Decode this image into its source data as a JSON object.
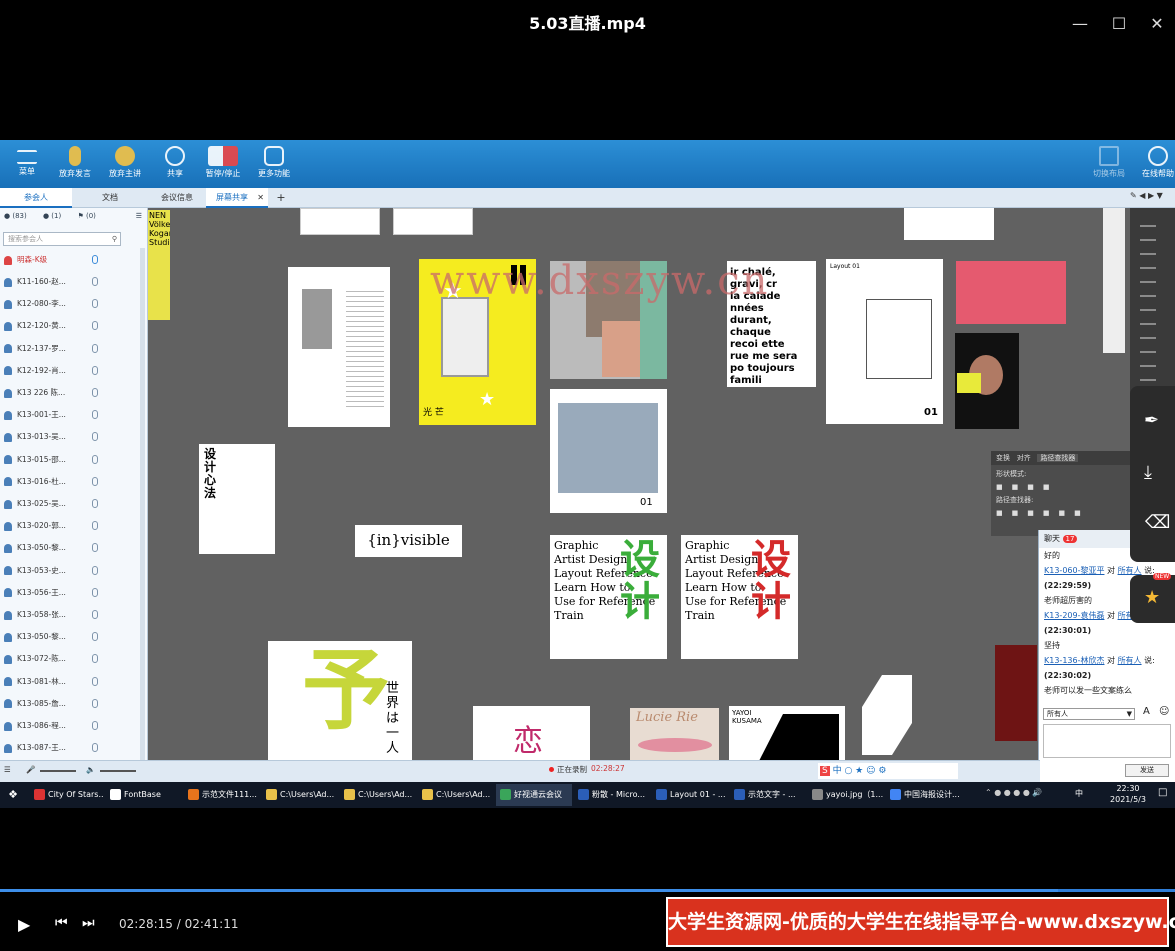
{
  "player": {
    "title": "5.03直播.mp4",
    "time_display": "02:28:15 / 02:41:11",
    "progress": 0.9,
    "banner": "大学生资源网-优质的大学生在线指导平台-www.dxszyw.cn"
  },
  "watermark": "www.dxszyw.cn",
  "toolbar": {
    "menu": "菜单",
    "give_speech": "放弃发言",
    "give_host": "放弃主讲",
    "share": "共享",
    "pause_stop": "暂停/停止",
    "more": "更多功能",
    "online_help": "在线帮助",
    "layout": "切换布局"
  },
  "tabs": {
    "participants": "参会人",
    "docs": "文档",
    "meeting_info": "会议信息",
    "screen_share": "屏幕共享",
    "add": "+"
  },
  "side": {
    "count_all": "(83)",
    "count_mic": "(1)",
    "count_flag": "(0)",
    "search_placeholder": "搜索参会人",
    "host": "明森-K级",
    "people": [
      "K11-160-赵...",
      "K12-080-李...",
      "K12-120-黄...",
      "K12-137-罗...",
      "K12-192-肖...",
      "K13 226 陈...",
      "K13-001-王...",
      "K13-013-吴...",
      "K13-015-邵...",
      "K13-016-杜...",
      "K13-025-吴...",
      "K13-020-郭...",
      "K13-050-黎...",
      "K13-053-史...",
      "K13-056-王...",
      "K13-058-张...",
      "K13-050-黎...",
      "K13-072-陈...",
      "K13-081-林...",
      "K13-085-詹...",
      "K13-086-程...",
      "K13-087-王..."
    ]
  },
  "stage": {
    "invisible": "{in}visible",
    "book_title": "设计心法",
    "poster1": [
      "Graphic",
      "Artist Design",
      "Layout Reference",
      "Learn How to",
      "Use for Reference",
      "Train"
    ],
    "poster_cn": "设计",
    "french": [
      "ir chalé,",
      "gravi, cr",
      "la calade",
      "nnées",
      "durant, chaque",
      "recoi     ette",
      "rue    me sera",
      "po     toujours",
      "famili"
    ],
    "layout_label": "Layout 01",
    "num01": "01",
    "ps_tabs": [
      "变换",
      "对齐",
      "路径查找器"
    ],
    "ps_shape_modes": "形状模式:",
    "ps_pathfinder": "路径查找器:",
    "yayoi": "YAYOI KUSAMA",
    "lucie": "Lucie Rie",
    "sekai": "世界は一人"
  },
  "chat": {
    "title": "聊天",
    "badge": "17",
    "lines": [
      {
        "type": "text",
        "v": "好的"
      },
      {
        "type": "who",
        "n": "K13-060-黎亚平",
        "to": "对",
        "r": "所有人",
        "s": "说:"
      },
      {
        "type": "time",
        "v": "(22:29:59)"
      },
      {
        "type": "text",
        "v": "老师超厉害的"
      },
      {
        "type": "who",
        "n": "K13-209-袁伟磊",
        "to": "对",
        "r": "所有人",
        "s": "说:"
      },
      {
        "type": "time",
        "v": "(22:30:01)"
      },
      {
        "type": "text",
        "v": "坚持"
      },
      {
        "type": "who",
        "n": "K13-136-林欣杰",
        "to": "对",
        "r": "所有人",
        "s": "说:"
      },
      {
        "type": "time",
        "v": "(22:30:02)"
      },
      {
        "type": "text",
        "v": "老师可以发一些文案练么"
      }
    ],
    "recipient": "所有人",
    "send": "发送",
    "new_badge": "NEW"
  },
  "status": {
    "recording": "正在录制",
    "rec_time": "02:28:27"
  },
  "taskbar": {
    "items": [
      "City Of Stars...",
      "FontBase",
      "示范文件111...",
      "C:\\Users\\Ad...",
      "C:\\Users\\Ad...",
      "C:\\Users\\Ad...",
      "好视通云会议",
      "粉散 - Micro...",
      "Layout 01 - ...",
      "示范文字 - ...",
      "yayoi.jpg（1...",
      "中国海报设计..."
    ],
    "colors": [
      "#d33",
      "#fff",
      "#e8741c",
      "#e8c14a",
      "#e8c14a",
      "#e8c14a",
      "#3aa55a",
      "#2b5eb8",
      "#2b5eb8",
      "#2b5eb8",
      "#888",
      "#4285f4"
    ],
    "clock_time": "22:30",
    "clock_date": "2021/5/3",
    "lang": "中"
  }
}
